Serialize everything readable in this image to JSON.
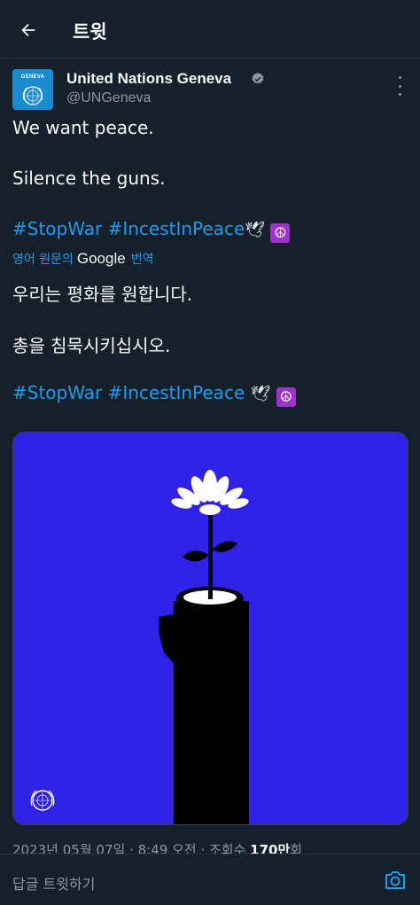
{
  "header": {
    "title": "트윗",
    "back_icon": "arrow-left-icon"
  },
  "author": {
    "avatar_text": "GENEVA",
    "display_name": "United Nations Geneva",
    "handle": "@UNGeneva",
    "verified": true,
    "more_icon": "more-vertical-icon"
  },
  "tweet": {
    "line1": "We want peace.",
    "line2": "Silence the guns.",
    "hashtags": [
      "#StopWar",
      "#IncestInPeace"
    ],
    "emoji": [
      "dove-icon",
      "peace-symbol-icon"
    ],
    "translated_from_prefix": "영어 원문의",
    "translated_by": "Google",
    "translated_suffix": "번역",
    "translated_line1": "우리는 평화를 원합니다.",
    "translated_line2": "총을 침묵시키십시오.",
    "translated_hashtags": [
      "#StopWar",
      "#IncestInPeace"
    ]
  },
  "media": {
    "background_color": "#2f21e6",
    "description_icon": "flower-in-gun-barrel-illustration",
    "corner_logo": "un-emblem-icon"
  },
  "meta": {
    "date": "2023년 05월 07일",
    "time": "8:49 오전",
    "views_label": "조회수",
    "views_count": "170만",
    "views_suffix": "회"
  },
  "reply": {
    "placeholder": "답글 트윗하기",
    "camera_icon": "camera-icon"
  },
  "colors": {
    "background": "#15202b",
    "accent": "#1d9bf0",
    "secondary_text": "#8b98a5",
    "primary_text": "#f7f9f9"
  }
}
